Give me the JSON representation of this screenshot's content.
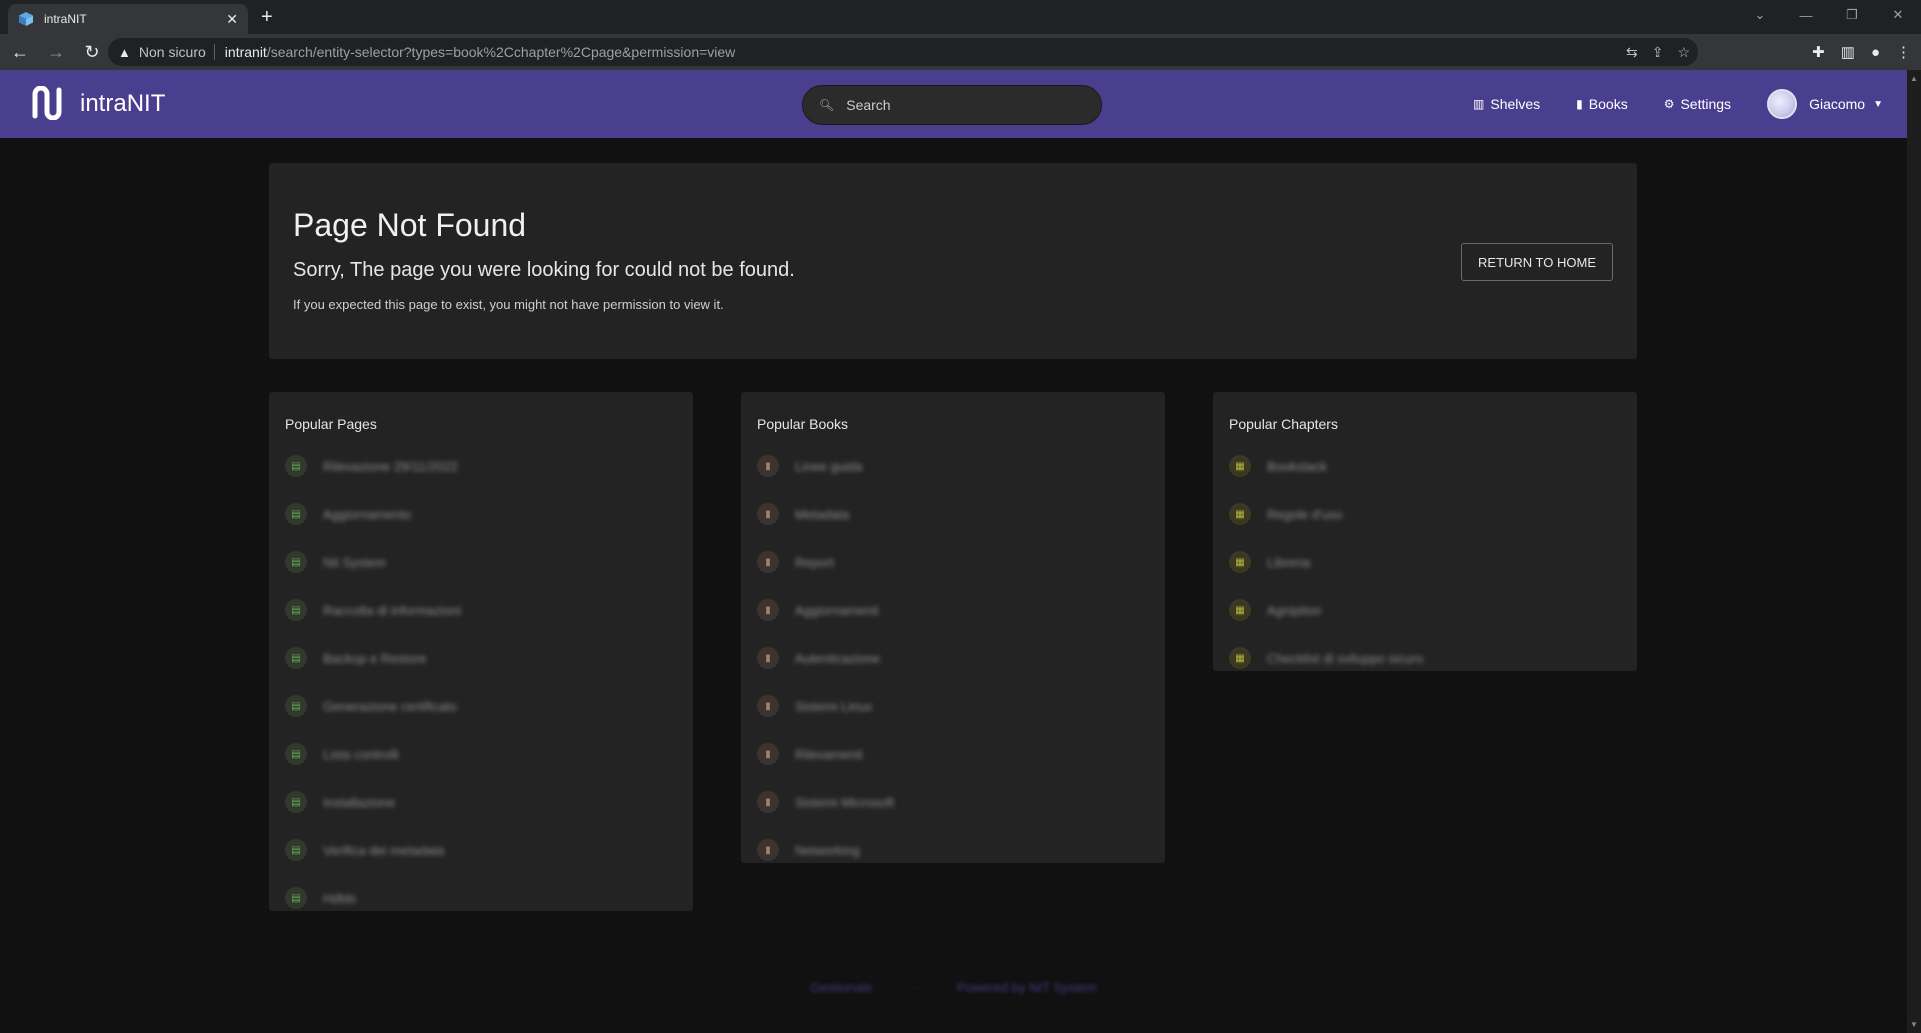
{
  "browser": {
    "tab_title": "intraNIT",
    "not_secure": "Non sicuro",
    "url_host": "intranit",
    "url_rest": "/search/entity-selector?types=book%2Cchapter%2Cpage&permission=view"
  },
  "header": {
    "logo_text": "intraNIT",
    "search_placeholder": "Search",
    "nav": {
      "shelves": "Shelves",
      "books": "Books",
      "settings": "Settings",
      "user": "Giacomo"
    },
    "accent_color": "#4a3f8f"
  },
  "error": {
    "title": "Page Not Found",
    "subtitle": "Sorry, The page you were looking for could not be found.",
    "note": "If you expected this page to exist, you might not have permission to view it.",
    "return_button": "RETURN TO HOME"
  },
  "popular_pages": {
    "title": "Popular Pages",
    "items": [
      {
        "label": "Rilevazione 29/11/2022"
      },
      {
        "label": "Aggiornamento"
      },
      {
        "label": "Nit System"
      },
      {
        "label": "Raccolta di informazioni"
      },
      {
        "label": "Backup e Restore"
      },
      {
        "label": "Generazione certificato"
      },
      {
        "label": "Lista controlli"
      },
      {
        "label": "Installazione"
      },
      {
        "label": "Verifica dei metadata"
      },
      {
        "label": "Hdlds"
      }
    ]
  },
  "popular_books": {
    "title": "Popular Books",
    "items": [
      {
        "label": "Linee guida"
      },
      {
        "label": "Metadata"
      },
      {
        "label": "Report"
      },
      {
        "label": "Aggiornamenti"
      },
      {
        "label": "Autenticazione"
      },
      {
        "label": "Sistemi Linux"
      },
      {
        "label": "Rilevamenti"
      },
      {
        "label": "Sistemi Microsoft"
      },
      {
        "label": "Networking"
      }
    ]
  },
  "popular_chapters": {
    "title": "Popular Chapters",
    "items": [
      {
        "label": "Bookstack"
      },
      {
        "label": "Regole d'uso"
      },
      {
        "label": "Libreria"
      },
      {
        "label": "Agniption"
      },
      {
        "label": "Checklist di sviluppo sicuro"
      }
    ]
  },
  "footer": {
    "link1": "Gestionale",
    "link2": "Powered by NIT System"
  }
}
